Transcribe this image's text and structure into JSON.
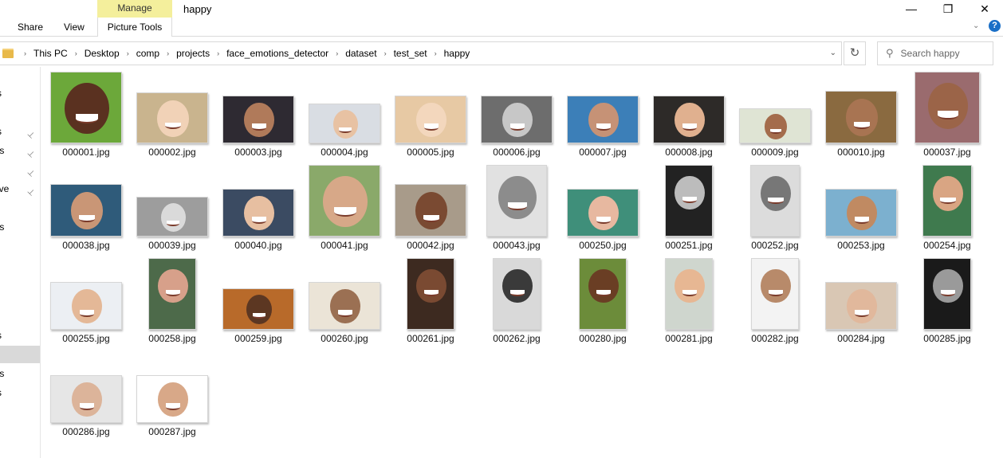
{
  "window": {
    "title": "happy",
    "minimize_glyph": "—",
    "restore_glyph": "❐",
    "close_glyph": "✕"
  },
  "ribbon": {
    "tabs": [
      {
        "label": "Share"
      },
      {
        "label": "View"
      }
    ],
    "context_group": "Manage",
    "context_tab": "Picture Tools",
    "expand_glyph": "⌄",
    "help_glyph": "?"
  },
  "address": {
    "crumbs": [
      "This PC",
      "Desktop",
      "comp",
      "projects",
      "face_emotions_detector",
      "dataset",
      "test_set",
      "happy"
    ],
    "separator": "›",
    "dropdown_glyph": "⌄",
    "refresh_glyph": "↻"
  },
  "search": {
    "placeholder": "Search happy",
    "icon": "search-icon"
  },
  "nav": {
    "items": [
      {
        "label": "s",
        "pinned": false
      },
      {
        "label": "s",
        "pinned": true
      },
      {
        "label": "ts",
        "pinned": true
      },
      {
        "label": "",
        "pinned": true
      },
      {
        "label": "ive",
        "pinned": true
      },
      {
        "label": "ts",
        "pinned": false
      },
      {
        "label": "s",
        "pinned": false
      },
      {
        "label": "",
        "pinned": false,
        "selected": true
      },
      {
        "label": "ts",
        "pinned": false
      },
      {
        "label": "s",
        "pinned": false
      }
    ],
    "pin_glyph": "📌"
  },
  "files": [
    {
      "name": "000001.jpg",
      "bg": "#6ca83a",
      "skin": "#5a3120"
    },
    {
      "name": "000002.jpg",
      "bg": "#c9b48e",
      "skin": "#f1d2b7"
    },
    {
      "name": "000003.jpg",
      "bg": "#2e2a32",
      "skin": "#b07a5a"
    },
    {
      "name": "000004.jpg",
      "bg": "#d9dde3",
      "skin": "#e8c2a3"
    },
    {
      "name": "000005.jpg",
      "bg": "#e7c9a4",
      "skin": "#f3d7bd"
    },
    {
      "name": "000006.jpg",
      "bg": "#6d6d6d",
      "skin": "#c7c7c7"
    },
    {
      "name": "000007.jpg",
      "bg": "#3c7fb8",
      "skin": "#c69276"
    },
    {
      "name": "000008.jpg",
      "bg": "#2d2a28",
      "skin": "#e0b08f"
    },
    {
      "name": "000009.jpg",
      "bg": "#dfe4d4",
      "skin": "#a46c4c"
    },
    {
      "name": "000010.jpg",
      "bg": "#8a6a40",
      "skin": "#a87452"
    },
    {
      "name": "000037.jpg",
      "bg": "#9a6b6e",
      "skin": "#9b6448"
    },
    {
      "name": "000038.jpg",
      "bg": "#2f5b7a",
      "skin": "#c99676"
    },
    {
      "name": "000039.jpg",
      "bg": "#9d9d9d",
      "skin": "#dadada"
    },
    {
      "name": "000040.jpg",
      "bg": "#3b4b62",
      "skin": "#e7bfa1"
    },
    {
      "name": "000041.jpg",
      "bg": "#8aa96a",
      "skin": "#d7a888"
    },
    {
      "name": "000042.jpg",
      "bg": "#a89b8a",
      "skin": "#7a4a32"
    },
    {
      "name": "000043.jpg",
      "bg": "#e1e1e1",
      "skin": "#8c8c8c"
    },
    {
      "name": "000250.jpg",
      "bg": "#3f8f7a",
      "skin": "#e7b8a0"
    },
    {
      "name": "000251.jpg",
      "bg": "#222222",
      "skin": "#bcbcbc"
    },
    {
      "name": "000252.jpg",
      "bg": "#dcdcdc",
      "skin": "#777777"
    },
    {
      "name": "000253.jpg",
      "bg": "#7cb0cf",
      "skin": "#c08a62"
    },
    {
      "name": "000254.jpg",
      "bg": "#3f7a4e",
      "skin": "#d9a583"
    },
    {
      "name": "000255.jpg",
      "bg": "#eceff3",
      "skin": "#e4b897"
    },
    {
      "name": "000258.jpg",
      "bg": "#4d6a4a",
      "skin": "#d7a08a"
    },
    {
      "name": "000259.jpg",
      "bg": "#b86a2a",
      "skin": "#5c3722"
    },
    {
      "name": "000260.jpg",
      "bg": "#ebe4d7",
      "skin": "#9b7053"
    },
    {
      "name": "000261.jpg",
      "bg": "#3d2a20",
      "skin": "#7a4a32"
    },
    {
      "name": "000262.jpg",
      "bg": "#d9d9d9",
      "skin": "#3a3a3a"
    },
    {
      "name": "000280.jpg",
      "bg": "#6c8c3a",
      "skin": "#6a3e24"
    },
    {
      "name": "000281.jpg",
      "bg": "#cfd6ce",
      "skin": "#e7b793"
    },
    {
      "name": "000282.jpg",
      "bg": "#f3f3f3",
      "skin": "#b88a6a"
    },
    {
      "name": "000284.jpg",
      "bg": "#d9c7b4",
      "skin": "#e1b89c"
    },
    {
      "name": "000285.jpg",
      "bg": "#1a1a1a",
      "skin": "#9a9a9a"
    },
    {
      "name": "000286.jpg",
      "bg": "#e6e6e6",
      "skin": "#dcb49a"
    },
    {
      "name": "000287.jpg",
      "bg": "#ffffff",
      "skin": "#d8a888"
    }
  ]
}
